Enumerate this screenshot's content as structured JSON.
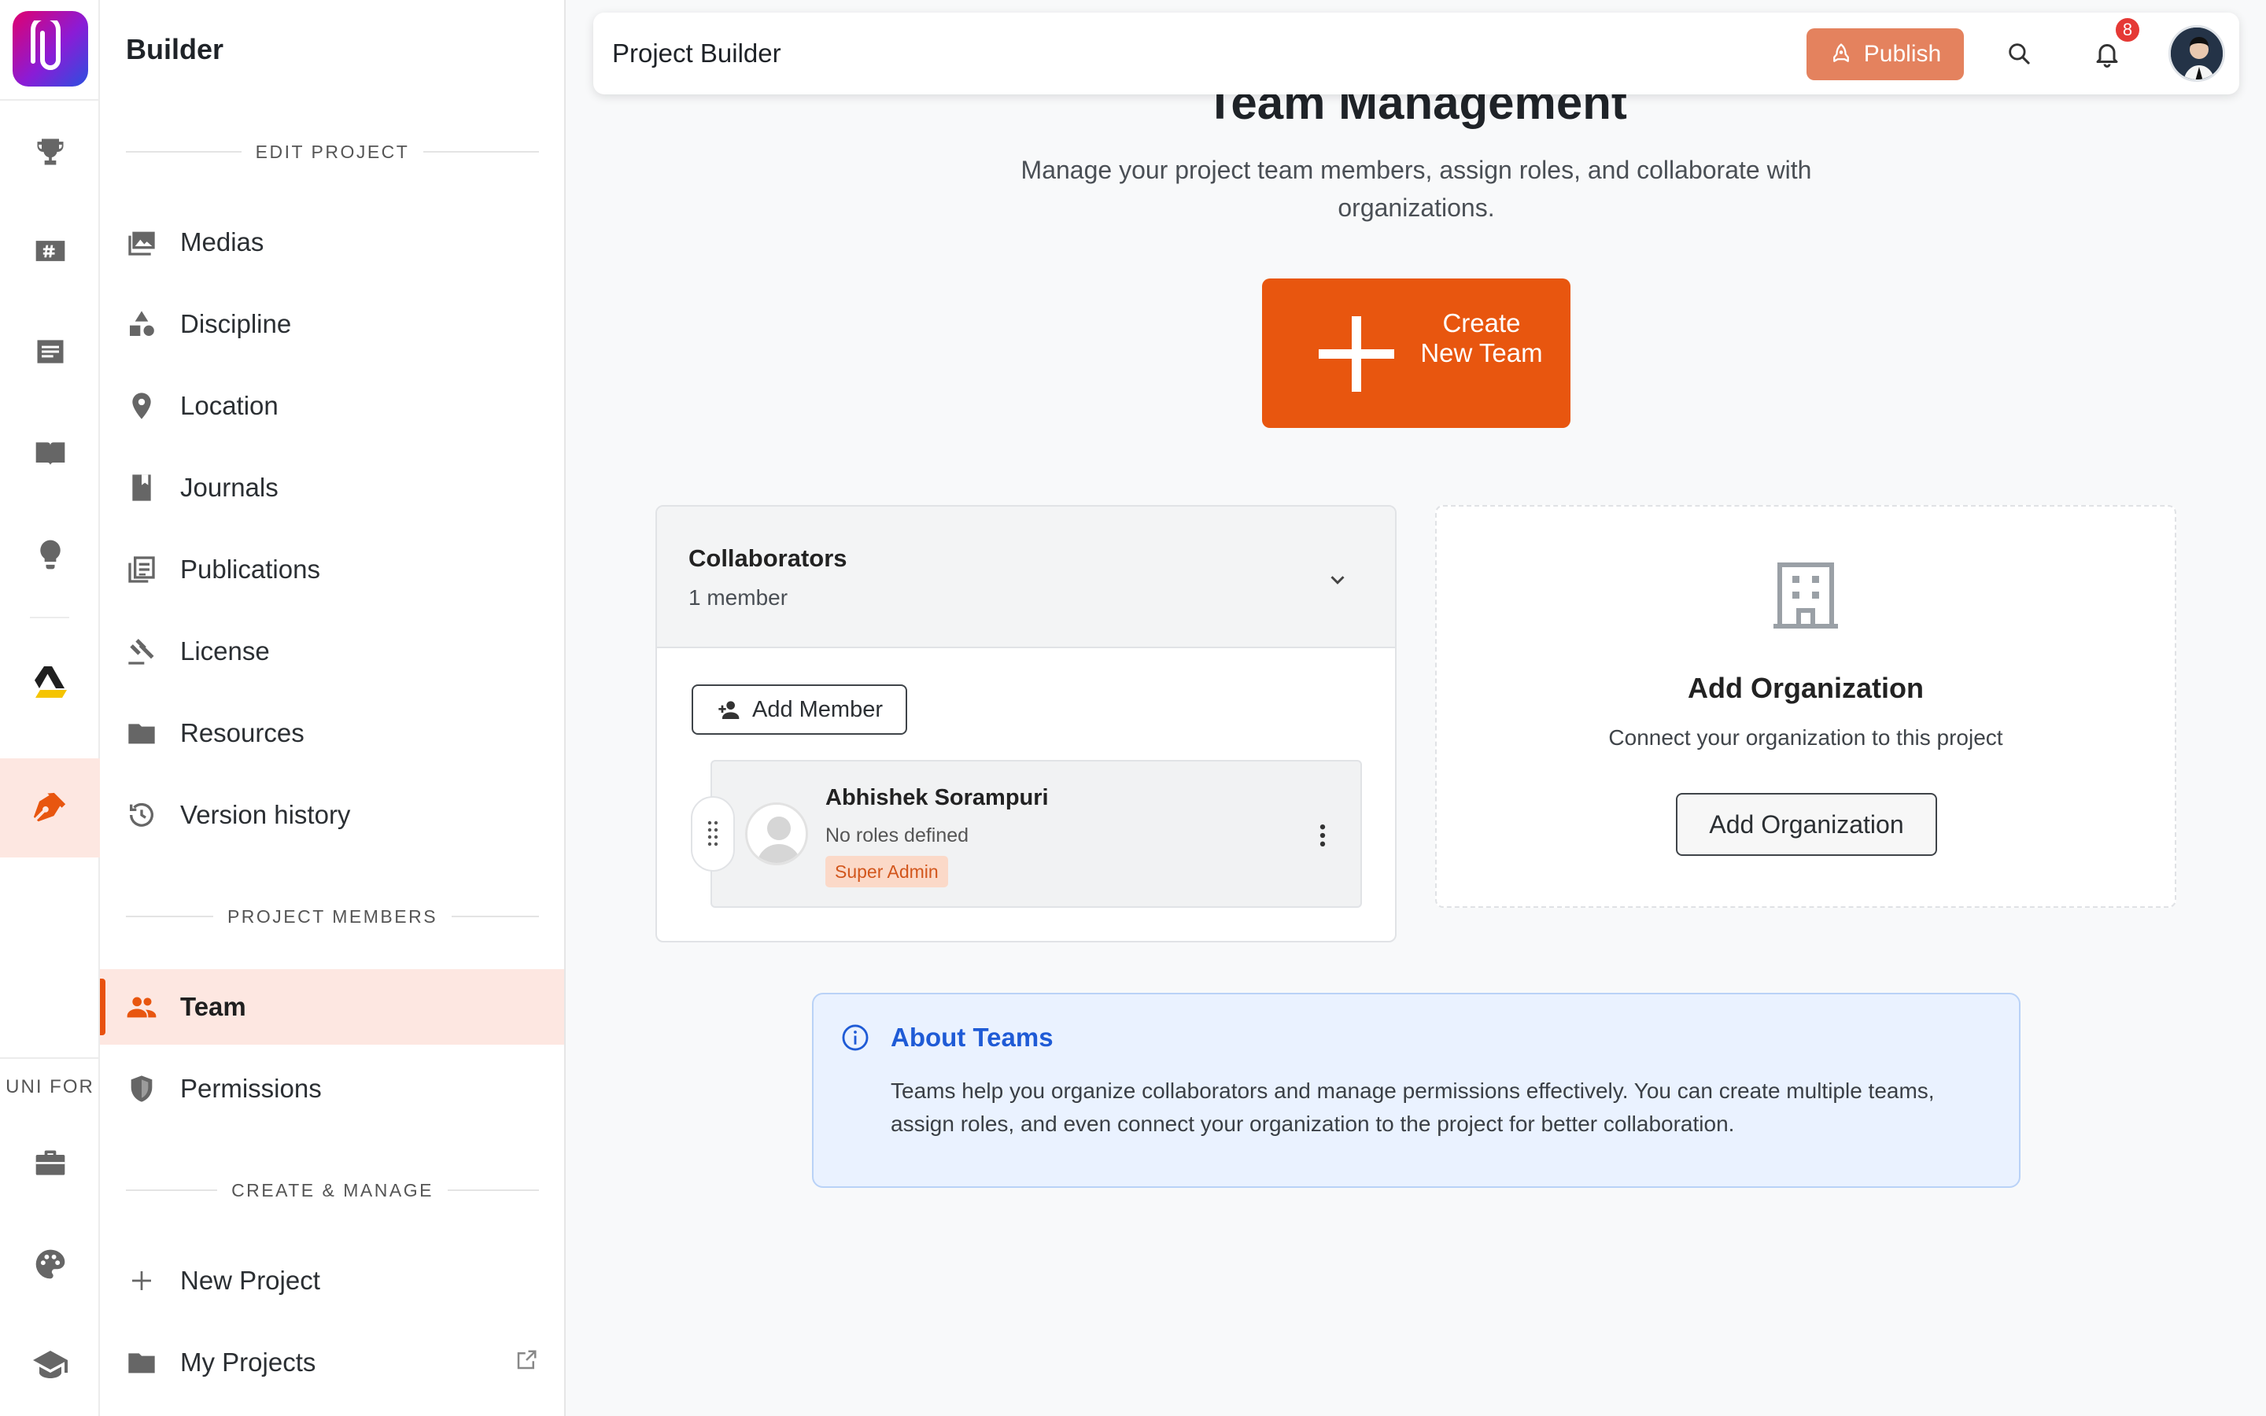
{
  "app": {
    "brand_title": "Builder",
    "accent": "#e8560f"
  },
  "topbar": {
    "title": "Project Builder",
    "publish_label": "Publish",
    "notification_count": "8"
  },
  "rail": {
    "caption": "UNI FOR",
    "items": [
      {
        "icon": "trophy-icon"
      },
      {
        "icon": "hashtag-board-icon"
      },
      {
        "icon": "article-icon"
      },
      {
        "icon": "open-book-icon"
      },
      {
        "icon": "lightbulb-icon"
      },
      {
        "icon": "drive-icon"
      },
      {
        "icon": "pen-tool-icon",
        "active": true
      },
      {
        "icon": "briefcase-icon"
      },
      {
        "icon": "palette-icon"
      },
      {
        "icon": "graduation-cap-icon"
      }
    ]
  },
  "sidebar": {
    "sections": {
      "edit_project": "EDIT PROJECT",
      "project_members": "PROJECT MEMBERS",
      "create_manage": "CREATE & MANAGE"
    },
    "edit_items": [
      {
        "label": "Medias"
      },
      {
        "label": "Discipline"
      },
      {
        "label": "Location"
      },
      {
        "label": "Journals"
      },
      {
        "label": "Publications"
      },
      {
        "label": "License"
      },
      {
        "label": "Resources"
      },
      {
        "label": "Version history"
      }
    ],
    "member_items": [
      {
        "label": "Team",
        "active": true
      },
      {
        "label": "Permissions"
      }
    ],
    "create_items": [
      {
        "label": "New Project"
      },
      {
        "label": "My Projects"
      }
    ]
  },
  "main": {
    "heading": "Team Management",
    "subtitle": "Manage your project team members, assign roles, and collaborate with organizations.",
    "create_team_label": "Create New Team",
    "collaborators": {
      "title": "Collaborators",
      "count": "1 member",
      "add_member_label": "Add Member",
      "members": [
        {
          "name": "Abhishek Sorampuri",
          "roles": "No roles defined",
          "badge": "Super Admin"
        }
      ]
    },
    "organization": {
      "title": "Add Organization",
      "subtitle": "Connect your organization to this project",
      "button_label": "Add Organization"
    },
    "about": {
      "title": "About Teams",
      "text": "Teams help you organize collaborators and manage permissions effectively. You can create multiple teams, assign roles, and even connect your organization to the project for better collaboration."
    }
  }
}
